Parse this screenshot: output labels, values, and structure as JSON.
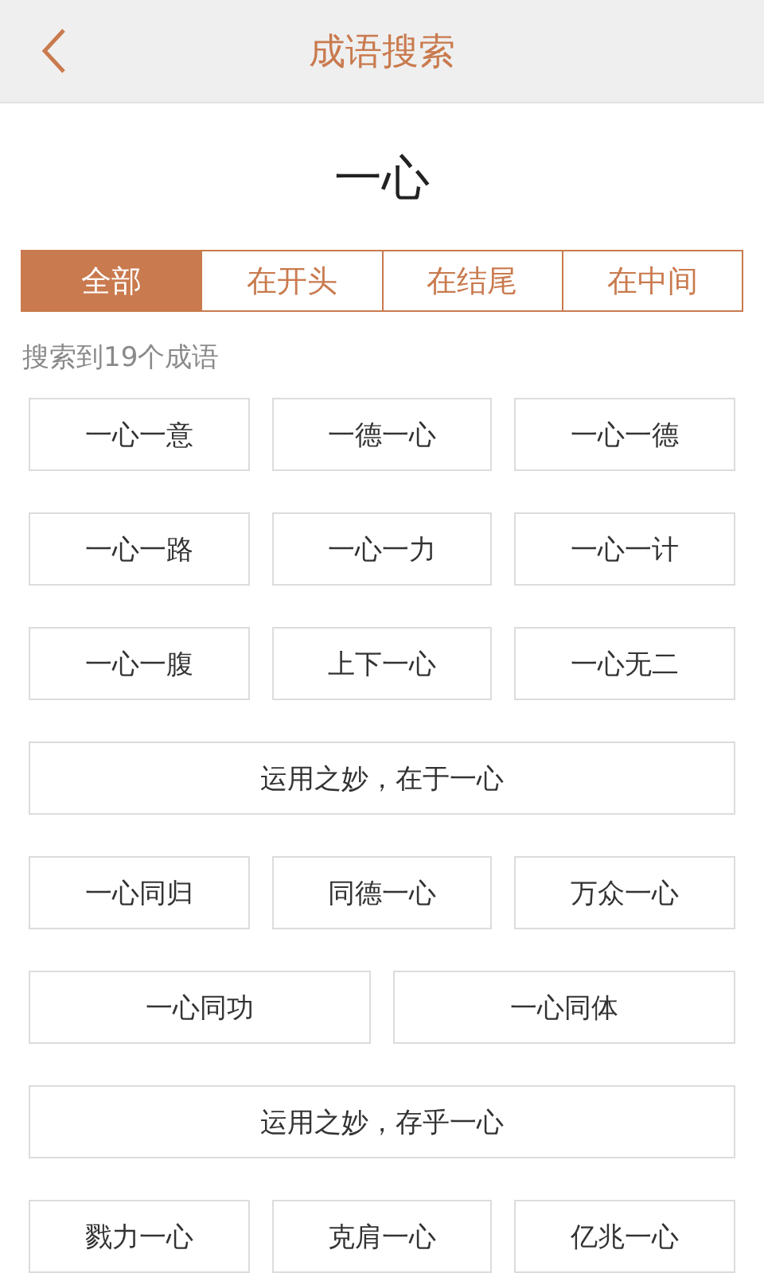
{
  "header": {
    "title": "成语搜索"
  },
  "query": "一心",
  "tabs": [
    {
      "label": "全部",
      "selected": true
    },
    {
      "label": "在开头",
      "selected": false
    },
    {
      "label": "在结尾",
      "selected": false
    },
    {
      "label": "在中间",
      "selected": false
    }
  ],
  "result_count": "搜索到19个成语",
  "rows": [
    [
      "一心一意",
      "一德一心",
      "一心一德"
    ],
    [
      "一心一路",
      "一心一力",
      "一心一计"
    ],
    [
      "一心一腹",
      "上下一心",
      "一心无二"
    ],
    [
      "运用之妙，在于一心"
    ],
    [
      "一心同归",
      "同德一心",
      "万众一心"
    ],
    [
      "一心同功",
      "一心同体"
    ],
    [
      "运用之妙，存乎一心"
    ],
    [
      "戮力一心",
      "克肩一心",
      "亿兆一心"
    ]
  ]
}
